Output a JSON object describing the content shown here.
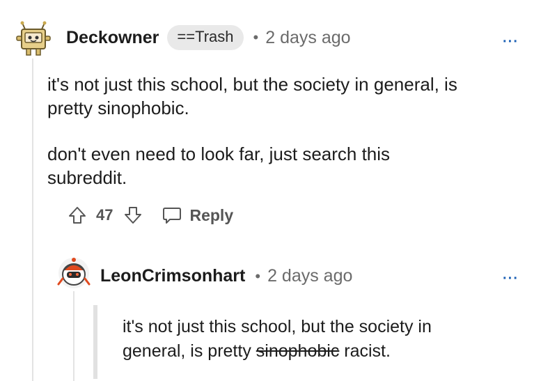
{
  "comment": {
    "username": "Deckowner",
    "flair": "==Trash",
    "separator": "•",
    "timestamp": "2 days ago",
    "more_label": "···",
    "avatar_icon": "boxy-robot-avatar-icon",
    "paragraphs": [
      "it's not just this school, but the society in general, is pretty sinophobic.",
      "don't even need to look far, just search this subreddit."
    ],
    "score": "47",
    "reply_label": "Reply",
    "icons": {
      "upvote": "upvote-arrow-icon",
      "downvote": "downvote-arrow-icon",
      "reply": "speech-bubble-icon"
    }
  },
  "reply": {
    "username": "LeonCrimsonhart",
    "separator": "•",
    "timestamp": "2 days ago",
    "more_label": "···",
    "avatar_icon": "robot-mascot-avatar-icon",
    "quote_text": "it's not just this school, but the society in general, is pretty",
    "struck_word": "sinophobic",
    "replacement_word": "racist."
  },
  "colors": {
    "accent": "#1a5fb4",
    "muted_text": "#6b6b6b",
    "flair_bg": "#e9e9e9",
    "thread_line": "#e3e3e3"
  }
}
